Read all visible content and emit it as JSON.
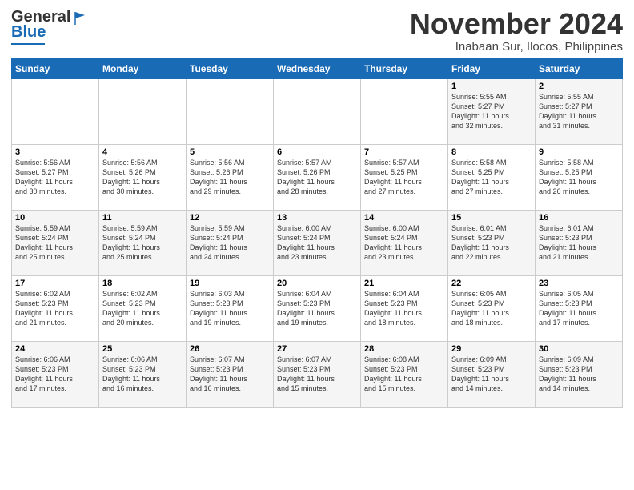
{
  "logo": {
    "line1": "General",
    "line2": "Blue"
  },
  "header": {
    "month": "November 2024",
    "location": "Inabaan Sur, Ilocos, Philippines"
  },
  "weekdays": [
    "Sunday",
    "Monday",
    "Tuesday",
    "Wednesday",
    "Thursday",
    "Friday",
    "Saturday"
  ],
  "weeks": [
    [
      {
        "day": "",
        "info": ""
      },
      {
        "day": "",
        "info": ""
      },
      {
        "day": "",
        "info": ""
      },
      {
        "day": "",
        "info": ""
      },
      {
        "day": "",
        "info": ""
      },
      {
        "day": "1",
        "info": "Sunrise: 5:55 AM\nSunset: 5:27 PM\nDaylight: 11 hours\nand 32 minutes."
      },
      {
        "day": "2",
        "info": "Sunrise: 5:55 AM\nSunset: 5:27 PM\nDaylight: 11 hours\nand 31 minutes."
      }
    ],
    [
      {
        "day": "3",
        "info": "Sunrise: 5:56 AM\nSunset: 5:27 PM\nDaylight: 11 hours\nand 30 minutes."
      },
      {
        "day": "4",
        "info": "Sunrise: 5:56 AM\nSunset: 5:26 PM\nDaylight: 11 hours\nand 30 minutes."
      },
      {
        "day": "5",
        "info": "Sunrise: 5:56 AM\nSunset: 5:26 PM\nDaylight: 11 hours\nand 29 minutes."
      },
      {
        "day": "6",
        "info": "Sunrise: 5:57 AM\nSunset: 5:26 PM\nDaylight: 11 hours\nand 28 minutes."
      },
      {
        "day": "7",
        "info": "Sunrise: 5:57 AM\nSunset: 5:25 PM\nDaylight: 11 hours\nand 27 minutes."
      },
      {
        "day": "8",
        "info": "Sunrise: 5:58 AM\nSunset: 5:25 PM\nDaylight: 11 hours\nand 27 minutes."
      },
      {
        "day": "9",
        "info": "Sunrise: 5:58 AM\nSunset: 5:25 PM\nDaylight: 11 hours\nand 26 minutes."
      }
    ],
    [
      {
        "day": "10",
        "info": "Sunrise: 5:59 AM\nSunset: 5:24 PM\nDaylight: 11 hours\nand 25 minutes."
      },
      {
        "day": "11",
        "info": "Sunrise: 5:59 AM\nSunset: 5:24 PM\nDaylight: 11 hours\nand 25 minutes."
      },
      {
        "day": "12",
        "info": "Sunrise: 5:59 AM\nSunset: 5:24 PM\nDaylight: 11 hours\nand 24 minutes."
      },
      {
        "day": "13",
        "info": "Sunrise: 6:00 AM\nSunset: 5:24 PM\nDaylight: 11 hours\nand 23 minutes."
      },
      {
        "day": "14",
        "info": "Sunrise: 6:00 AM\nSunset: 5:24 PM\nDaylight: 11 hours\nand 23 minutes."
      },
      {
        "day": "15",
        "info": "Sunrise: 6:01 AM\nSunset: 5:23 PM\nDaylight: 11 hours\nand 22 minutes."
      },
      {
        "day": "16",
        "info": "Sunrise: 6:01 AM\nSunset: 5:23 PM\nDaylight: 11 hours\nand 21 minutes."
      }
    ],
    [
      {
        "day": "17",
        "info": "Sunrise: 6:02 AM\nSunset: 5:23 PM\nDaylight: 11 hours\nand 21 minutes."
      },
      {
        "day": "18",
        "info": "Sunrise: 6:02 AM\nSunset: 5:23 PM\nDaylight: 11 hours\nand 20 minutes."
      },
      {
        "day": "19",
        "info": "Sunrise: 6:03 AM\nSunset: 5:23 PM\nDaylight: 11 hours\nand 19 minutes."
      },
      {
        "day": "20",
        "info": "Sunrise: 6:04 AM\nSunset: 5:23 PM\nDaylight: 11 hours\nand 19 minutes."
      },
      {
        "day": "21",
        "info": "Sunrise: 6:04 AM\nSunset: 5:23 PM\nDaylight: 11 hours\nand 18 minutes."
      },
      {
        "day": "22",
        "info": "Sunrise: 6:05 AM\nSunset: 5:23 PM\nDaylight: 11 hours\nand 18 minutes."
      },
      {
        "day": "23",
        "info": "Sunrise: 6:05 AM\nSunset: 5:23 PM\nDaylight: 11 hours\nand 17 minutes."
      }
    ],
    [
      {
        "day": "24",
        "info": "Sunrise: 6:06 AM\nSunset: 5:23 PM\nDaylight: 11 hours\nand 17 minutes."
      },
      {
        "day": "25",
        "info": "Sunrise: 6:06 AM\nSunset: 5:23 PM\nDaylight: 11 hours\nand 16 minutes."
      },
      {
        "day": "26",
        "info": "Sunrise: 6:07 AM\nSunset: 5:23 PM\nDaylight: 11 hours\nand 16 minutes."
      },
      {
        "day": "27",
        "info": "Sunrise: 6:07 AM\nSunset: 5:23 PM\nDaylight: 11 hours\nand 15 minutes."
      },
      {
        "day": "28",
        "info": "Sunrise: 6:08 AM\nSunset: 5:23 PM\nDaylight: 11 hours\nand 15 minutes."
      },
      {
        "day": "29",
        "info": "Sunrise: 6:09 AM\nSunset: 5:23 PM\nDaylight: 11 hours\nand 14 minutes."
      },
      {
        "day": "30",
        "info": "Sunrise: 6:09 AM\nSunset: 5:23 PM\nDaylight: 11 hours\nand 14 minutes."
      }
    ]
  ]
}
